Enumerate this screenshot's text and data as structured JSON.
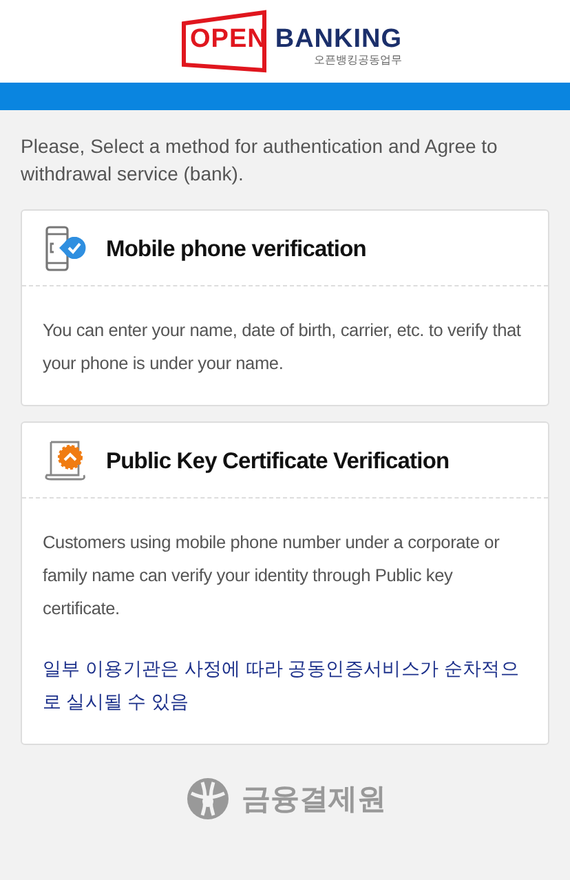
{
  "header": {
    "logo_part_1": "OPEN",
    "logo_part_2": "BANKING",
    "logo_subtitle": "오픈뱅킹공동업무"
  },
  "intro": "Please, Select a method for authentication and Agree to withdrawal service (bank).",
  "methods": [
    {
      "kind": "phone",
      "title": "Mobile phone verification",
      "description": "You can enter your name, date of birth, carrier, etc. to verify that your phone is under your name."
    },
    {
      "kind": "certificate",
      "title": "Public Key Certificate Verification",
      "description": "Customers using mobile phone number under a corporate or family name can verify your identity through Public key certificate.",
      "note": "일부 이용기관은 사정에 따라 공동인증서비스가 순차적으로 실시될 수 있음"
    }
  ],
  "footer": {
    "brand": "금융결제원"
  }
}
